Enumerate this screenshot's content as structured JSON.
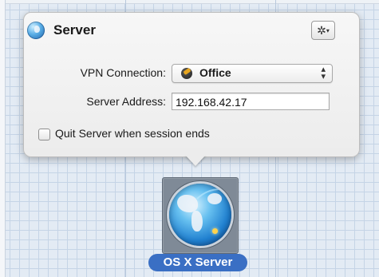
{
  "popover": {
    "title": "Server",
    "gear_icon": "gear-icon",
    "vpn_label": "VPN Connection:",
    "vpn_value": "Office",
    "address_label": "Server Address:",
    "address_value": "192.168.42.17",
    "quit_checkbox_label": "Quit Server when session ends",
    "quit_checked": false
  },
  "server_item": {
    "label": "OS X Server"
  },
  "colors": {
    "label_badge": "#3a6fc4",
    "grid_background": "#e3ebf4"
  }
}
